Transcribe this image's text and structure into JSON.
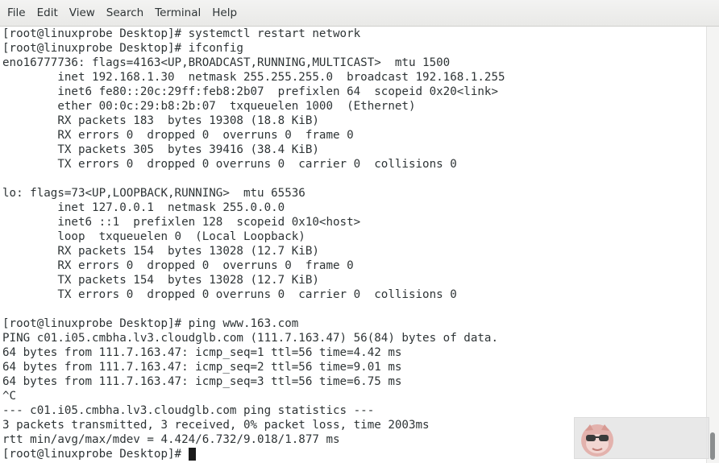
{
  "menubar": {
    "items": [
      "File",
      "Edit",
      "View",
      "Search",
      "Terminal",
      "Help"
    ]
  },
  "terminal": {
    "lines": [
      "[root@linuxprobe Desktop]# systemctl restart network",
      "[root@linuxprobe Desktop]# ifconfig",
      "eno16777736: flags=4163<UP,BROADCAST,RUNNING,MULTICAST>  mtu 1500",
      "        inet 192.168.1.30  netmask 255.255.255.0  broadcast 192.168.1.255",
      "        inet6 fe80::20c:29ff:feb8:2b07  prefixlen 64  scopeid 0x20<link>",
      "        ether 00:0c:29:b8:2b:07  txqueuelen 1000  (Ethernet)",
      "        RX packets 183  bytes 19308 (18.8 KiB)",
      "        RX errors 0  dropped 0  overruns 0  frame 0",
      "        TX packets 305  bytes 39416 (38.4 KiB)",
      "        TX errors 0  dropped 0 overruns 0  carrier 0  collisions 0",
      "",
      "lo: flags=73<UP,LOOPBACK,RUNNING>  mtu 65536",
      "        inet 127.0.0.1  netmask 255.0.0.0",
      "        inet6 ::1  prefixlen 128  scopeid 0x10<host>",
      "        loop  txqueuelen 0  (Local Loopback)",
      "        RX packets 154  bytes 13028 (12.7 KiB)",
      "        RX errors 0  dropped 0  overruns 0  frame 0",
      "        TX packets 154  bytes 13028 (12.7 KiB)",
      "        TX errors 0  dropped 0 overruns 0  carrier 0  collisions 0",
      "",
      "[root@linuxprobe Desktop]# ping www.163.com",
      "PING c01.i05.cmbha.lv3.cloudglb.com (111.7.163.47) 56(84) bytes of data.",
      "64 bytes from 111.7.163.47: icmp_seq=1 ttl=56 time=4.42 ms",
      "64 bytes from 111.7.163.47: icmp_seq=2 ttl=56 time=9.01 ms",
      "64 bytes from 111.7.163.47: icmp_seq=3 ttl=56 time=6.75 ms",
      "^C",
      "--- c01.i05.cmbha.lv3.cloudglb.com ping statistics ---",
      "3 packets transmitted, 3 received, 0% packet loss, time 2003ms",
      "rtt min/avg/max/mdev = 4.424/6.732/9.018/1.877 ms"
    ],
    "prompt": "[root@linuxprobe Desktop]# "
  },
  "watermark": {
    "icon": "mascot-face-icon"
  }
}
